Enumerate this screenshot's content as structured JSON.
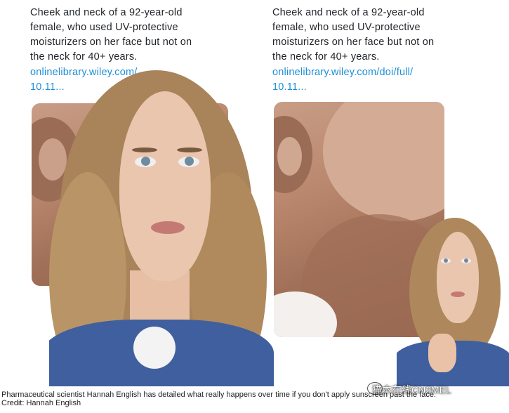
{
  "left_tweet": {
    "lines": [
      "Cheek and neck of a 92-year-old",
      "female, who used UV-protective",
      "moisturizers on her face but not on",
      "the neck for 40+ years."
    ],
    "link_lines": [
      "onlinelibrary.wiley.com/",
      "10.11..."
    ]
  },
  "right_tweet": {
    "lines": [
      "Cheek and neck of a 92-year-old",
      "female, who used UV-protective",
      "moisturizers on her face but not on",
      "the neck for 40+ years."
    ],
    "link_lines": [
      "onlinelibrary.wiley.com/doi/full/",
      "10.11..."
    ]
  },
  "caption": {
    "line1": "Pharmaceutical scientist Hannah English has detailed what really happens over time if you don't apply sunscreen past the face.",
    "line2": "Credit: Hannah English"
  },
  "watermark": {
    "text": "猫本在线CN2MEL"
  },
  "colors": {
    "link": "#1d8fd6",
    "text": "#1f2328",
    "skin_photo": "#b9876d",
    "hair": "#b08a5c"
  }
}
